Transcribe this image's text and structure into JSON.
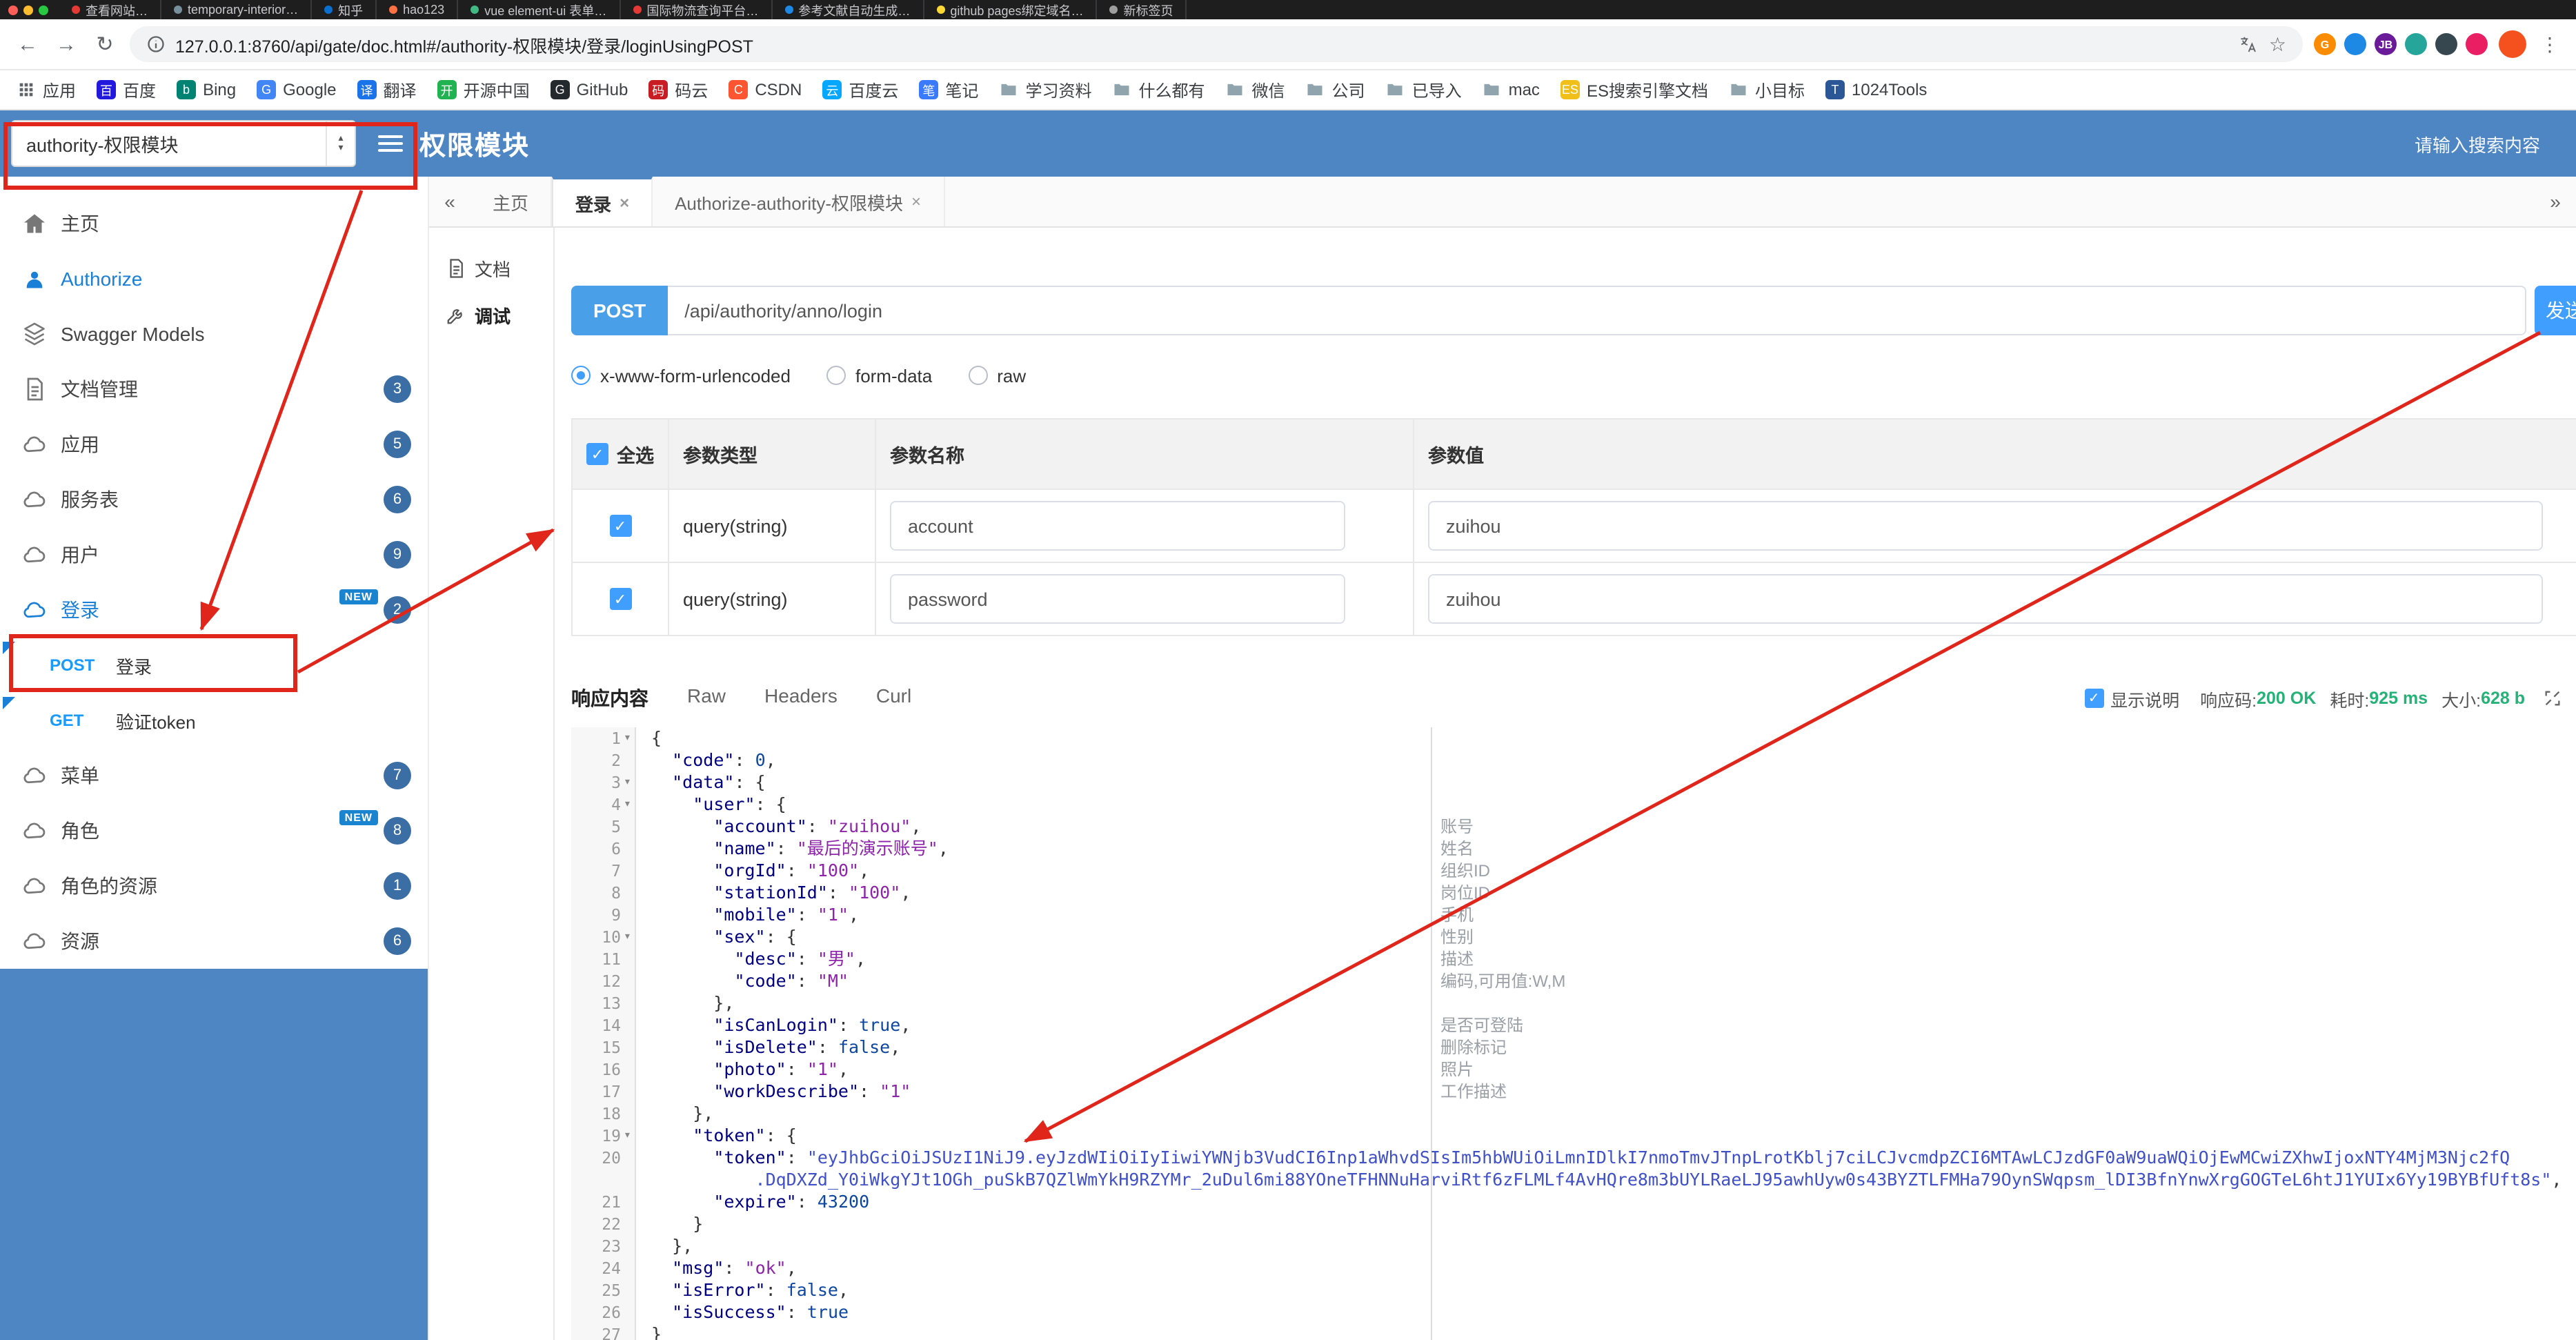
{
  "browser": {
    "tabs": [
      {
        "title": "查看网站…",
        "color": "#e53935"
      },
      {
        "title": "temporary-interior…",
        "color": "#78909c"
      },
      {
        "title": "知乎",
        "color": "#0b6fd0"
      },
      {
        "title": "hao123",
        "color": "#ff7043"
      },
      {
        "title": "vue element-ui 表单…",
        "color": "#42b983"
      },
      {
        "title": "国际物流查询平台…",
        "color": "#e53935"
      },
      {
        "title": "参考文献自动生成…",
        "color": "#1e88e5"
      },
      {
        "title": "github pages绑定域名…",
        "color": "#fdd835"
      },
      {
        "title": "新标签页",
        "color": "#9e9e9e"
      }
    ],
    "address": {
      "url": "127.0.0.1:8760/api/gate/doc.html#/authority-权限模块/登录/loginUsingPOST"
    },
    "extensions": [
      {
        "color": "#fb8c00",
        "text": "G"
      },
      {
        "color": "#1e88e5",
        "text": ""
      },
      {
        "color": "#6a1b9a",
        "text": "JB"
      },
      {
        "color": "#26a69a",
        "text": ""
      },
      {
        "color": "#37474f",
        "text": ""
      },
      {
        "color": "#e91e63",
        "text": ""
      }
    ],
    "bookmarks": [
      {
        "label": "应用",
        "icon": "grid"
      },
      {
        "label": "百度",
        "icon": "letter",
        "text": "百",
        "color": "#2319dc"
      },
      {
        "label": "Bing",
        "icon": "letter",
        "text": "b",
        "color": "#008373"
      },
      {
        "label": "Google",
        "icon": "letter",
        "text": "G",
        "color": "#4285f4"
      },
      {
        "label": "翻译",
        "icon": "letter",
        "text": "译",
        "color": "#1a73e8"
      },
      {
        "label": "开源中国",
        "icon": "letter",
        "text": "开",
        "color": "#21b351"
      },
      {
        "label": "GitHub",
        "icon": "letter",
        "text": "G",
        "color": "#24292e"
      },
      {
        "label": "码云",
        "icon": "letter",
        "text": "码",
        "color": "#c71d23"
      },
      {
        "label": "CSDN",
        "icon": "letter",
        "text": "C",
        "color": "#fc5531"
      },
      {
        "label": "百度云",
        "icon": "letter",
        "text": "云",
        "color": "#06a7ff"
      },
      {
        "label": "笔记",
        "icon": "letter",
        "text": "笔",
        "color": "#3a7afe"
      },
      {
        "label": "学习资料",
        "icon": "folder"
      },
      {
        "label": "什么都有",
        "icon": "folder"
      },
      {
        "label": "微信",
        "icon": "folder"
      },
      {
        "label": "公司",
        "icon": "folder"
      },
      {
        "label": "已导入",
        "icon": "folder"
      },
      {
        "label": "mac",
        "icon": "folder"
      },
      {
        "label": "ES搜索引擎文档",
        "icon": "letter",
        "text": "ES",
        "color": "#f0bf1a"
      },
      {
        "label": "小目标",
        "icon": "folder"
      },
      {
        "label": "1024Tools",
        "icon": "letter",
        "text": "T",
        "color": "#2b5797"
      }
    ]
  },
  "header": {
    "group_select": "authority-权限模块",
    "title": "权限模块",
    "search_placeholder": "请输入搜索内容"
  },
  "sidebar": {
    "new_label": "NEW",
    "items": [
      {
        "label": "主页",
        "icon": "home"
      },
      {
        "label": "Authorize",
        "icon": "auth",
        "active": true
      },
      {
        "label": "Swagger Models",
        "icon": "models"
      },
      {
        "label": "文档管理",
        "icon": "docs",
        "badge": "3"
      },
      {
        "label": "应用",
        "icon": "cloud",
        "badge": "5"
      },
      {
        "label": "服务表",
        "icon": "cloud",
        "badge": "6"
      },
      {
        "label": "用户",
        "icon": "cloud",
        "badge": "9"
      },
      {
        "label": "登录",
        "icon": "cloud",
        "badge": "2",
        "new": true,
        "active": true
      },
      {
        "label": "登录",
        "method": "POST",
        "endpoint": true
      },
      {
        "label": "验证token",
        "method": "GET",
        "endpoint": true
      },
      {
        "label": "菜单",
        "icon": "cloud",
        "badge": "7"
      },
      {
        "label": "角色",
        "icon": "cloud",
        "badge": "8",
        "new": true
      },
      {
        "label": "角色的资源",
        "icon": "cloud",
        "badge": "1"
      },
      {
        "label": "资源",
        "icon": "cloud",
        "badge": "6"
      }
    ]
  },
  "tabbar": {
    "scroll_left": "«",
    "scroll_right": "»",
    "tabs": [
      {
        "label": "主页"
      },
      {
        "label": "登录",
        "closable": true,
        "active": true
      },
      {
        "label": "Authorize-authority-权限模块",
        "closable": true
      }
    ]
  },
  "side_tabs": [
    {
      "label": "文档",
      "icon": "doc"
    },
    {
      "label": "调试",
      "icon": "debug",
      "active": true
    }
  ],
  "request": {
    "method": "POST",
    "path": "/api/authority/anno/login",
    "send_label": "发送",
    "content_types": [
      {
        "label": "x-www-form-urlencoded",
        "selected": true
      },
      {
        "label": "form-data",
        "selected": false
      },
      {
        "label": "raw",
        "selected": false
      }
    ]
  },
  "params_table": {
    "select_all": "全选",
    "col_type": "参数类型",
    "col_name": "参数名称",
    "col_value": "参数值",
    "rows": [
      {
        "checked": true,
        "type": "query(string)",
        "name": "account",
        "value": "zuihou"
      },
      {
        "checked": true,
        "type": "query(string)",
        "name": "password",
        "value": "zuihou"
      }
    ]
  },
  "response": {
    "tabs": [
      {
        "label": "响应内容",
        "active": true
      },
      {
        "label": "Raw"
      },
      {
        "label": "Headers"
      },
      {
        "label": "Curl"
      }
    ],
    "show_desc": "显示说明",
    "meta": [
      {
        "label": "响应码:",
        "value": "200 OK"
      },
      {
        "label": "耗时:",
        "value": "925 ms"
      },
      {
        "label": "大小:",
        "value": "628 b"
      }
    ]
  },
  "editor": {
    "lines": [
      {
        "n": "1",
        "fold": true,
        "segs": [
          [
            "pu",
            "{"
          ]
        ]
      },
      {
        "n": "2",
        "segs": [
          [
            "pu",
            "  "
          ],
          [
            "key",
            "\"code\""
          ],
          [
            "pu",
            ": "
          ],
          [
            "num",
            "0"
          ],
          [
            "pu",
            ","
          ]
        ]
      },
      {
        "n": "3",
        "fold": true,
        "segs": [
          [
            "pu",
            "  "
          ],
          [
            "key",
            "\"data\""
          ],
          [
            "pu",
            ": {"
          ]
        ]
      },
      {
        "n": "4",
        "fold": true,
        "segs": [
          [
            "pu",
            "    "
          ],
          [
            "key",
            "\"user\""
          ],
          [
            "pu",
            ": {"
          ]
        ]
      },
      {
        "n": "5",
        "segs": [
          [
            "pu",
            "      "
          ],
          [
            "key",
            "\"account\""
          ],
          [
            "pu",
            ": "
          ],
          [
            "str",
            "\"zuihou\""
          ],
          [
            "pu",
            ","
          ]
        ],
        "note": "账号"
      },
      {
        "n": "6",
        "segs": [
          [
            "pu",
            "      "
          ],
          [
            "key",
            "\"name\""
          ],
          [
            "pu",
            ": "
          ],
          [
            "str",
            "\"最后的演示账号\""
          ],
          [
            "pu",
            ","
          ]
        ],
        "note": "姓名"
      },
      {
        "n": "7",
        "segs": [
          [
            "pu",
            "      "
          ],
          [
            "key",
            "\"orgId\""
          ],
          [
            "pu",
            ": "
          ],
          [
            "str",
            "\"100\""
          ],
          [
            "pu",
            ","
          ]
        ],
        "note": "组织ID"
      },
      {
        "n": "8",
        "segs": [
          [
            "pu",
            "      "
          ],
          [
            "key",
            "\"stationId\""
          ],
          [
            "pu",
            ": "
          ],
          [
            "str",
            "\"100\""
          ],
          [
            "pu",
            ","
          ]
        ],
        "note": "岗位ID"
      },
      {
        "n": "9",
        "segs": [
          [
            "pu",
            "      "
          ],
          [
            "key",
            "\"mobile\""
          ],
          [
            "pu",
            ": "
          ],
          [
            "str",
            "\"1\""
          ],
          [
            "pu",
            ","
          ]
        ],
        "note": "手机"
      },
      {
        "n": "10",
        "fold": true,
        "segs": [
          [
            "pu",
            "      "
          ],
          [
            "key",
            "\"sex\""
          ],
          [
            "pu",
            ": {"
          ]
        ],
        "note": "性别"
      },
      {
        "n": "11",
        "segs": [
          [
            "pu",
            "        "
          ],
          [
            "key",
            "\"desc\""
          ],
          [
            "pu",
            ": "
          ],
          [
            "str",
            "\"男\""
          ],
          [
            "pu",
            ","
          ]
        ],
        "note": "描述"
      },
      {
        "n": "12",
        "segs": [
          [
            "pu",
            "        "
          ],
          [
            "key",
            "\"code\""
          ],
          [
            "pu",
            ": "
          ],
          [
            "str",
            "\"M\""
          ]
        ],
        "note": "编码,可用值:W,M"
      },
      {
        "n": "13",
        "segs": [
          [
            "pu",
            "      },"
          ]
        ]
      },
      {
        "n": "14",
        "segs": [
          [
            "pu",
            "      "
          ],
          [
            "key",
            "\"isCanLogin\""
          ],
          [
            "pu",
            ": "
          ],
          [
            "bool",
            "true"
          ],
          [
            "pu",
            ","
          ]
        ],
        "note": "是否可登陆"
      },
      {
        "n": "15",
        "segs": [
          [
            "pu",
            "      "
          ],
          [
            "key",
            "\"isDelete\""
          ],
          [
            "pu",
            ": "
          ],
          [
            "bool",
            "false"
          ],
          [
            "pu",
            ","
          ]
        ],
        "note": "删除标记"
      },
      {
        "n": "16",
        "segs": [
          [
            "pu",
            "      "
          ],
          [
            "key",
            "\"photo\""
          ],
          [
            "pu",
            ": "
          ],
          [
            "str",
            "\"1\""
          ],
          [
            "pu",
            ","
          ]
        ],
        "note": "照片"
      },
      {
        "n": "17",
        "segs": [
          [
            "pu",
            "      "
          ],
          [
            "key",
            "\"workDescribe\""
          ],
          [
            "pu",
            ": "
          ],
          [
            "str",
            "\"1\""
          ]
        ],
        "note": "工作描述"
      },
      {
        "n": "18",
        "segs": [
          [
            "pu",
            "    },"
          ]
        ]
      },
      {
        "n": "19",
        "fold": true,
        "segs": [
          [
            "pu",
            "    "
          ],
          [
            "key",
            "\"token\""
          ],
          [
            "pu",
            ": {"
          ]
        ]
      },
      {
        "n": "20",
        "segs": [
          [
            "pu",
            "      "
          ],
          [
            "key",
            "\"token\""
          ],
          [
            "pu",
            ": "
          ],
          [
            "tok",
            "\"eyJhbGciOiJSUzI1NiJ9.eyJzdWIiOiIyIiwiYWNjb3VudCI6Inp1aWhvdSIsIm5hbWUiOiLmnIDlkI7nmoTmvJTnpLrotKblj7ciLCJvcmdpZCI6MTAwLCJzdGF0aW9uaWQiOjEwMCwiZXhwIjoxNTY4MjM3Njc2fQ"
          ]
        ]
      },
      {
        "n": "",
        "segs": [
          [
            "pu",
            "          "
          ],
          [
            "tok",
            ".DqDXZd_Y0iWkgYJt1OGh_puSkB7QZlWmYkH9RZYMr_2uDul6mi88YOneTFHNNuHarviRtf6zFLMLf4AvHQre8m3bUYLRaeLJ95awhUyw0s43BYZTLFMHa79OynSWqpsm_lDI3BfnYnwXrgGOGTeL6htJ1YUIx6Yy19BYBfUft8s\""
          ],
          [
            "pu",
            ","
          ]
        ]
      },
      {
        "n": "21",
        "segs": [
          [
            "pu",
            "      "
          ],
          [
            "key",
            "\"expire\""
          ],
          [
            "pu",
            ": "
          ],
          [
            "num",
            "43200"
          ]
        ]
      },
      {
        "n": "22",
        "segs": [
          [
            "pu",
            "    }"
          ]
        ]
      },
      {
        "n": "23",
        "segs": [
          [
            "pu",
            "  },"
          ]
        ]
      },
      {
        "n": "24",
        "segs": [
          [
            "pu",
            "  "
          ],
          [
            "key",
            "\"msg\""
          ],
          [
            "pu",
            ": "
          ],
          [
            "str",
            "\"ok\""
          ],
          [
            "pu",
            ","
          ]
        ]
      },
      {
        "n": "25",
        "segs": [
          [
            "pu",
            "  "
          ],
          [
            "key",
            "\"isError\""
          ],
          [
            "pu",
            ": "
          ],
          [
            "bool",
            "false"
          ],
          [
            "pu",
            ","
          ]
        ]
      },
      {
        "n": "26",
        "segs": [
          [
            "pu",
            "  "
          ],
          [
            "key",
            "\"isSuccess\""
          ],
          [
            "pu",
            ": "
          ],
          [
            "bool",
            "true"
          ]
        ]
      },
      {
        "n": "27",
        "segs": [
          [
            "pu",
            "}"
          ]
        ]
      }
    ]
  }
}
